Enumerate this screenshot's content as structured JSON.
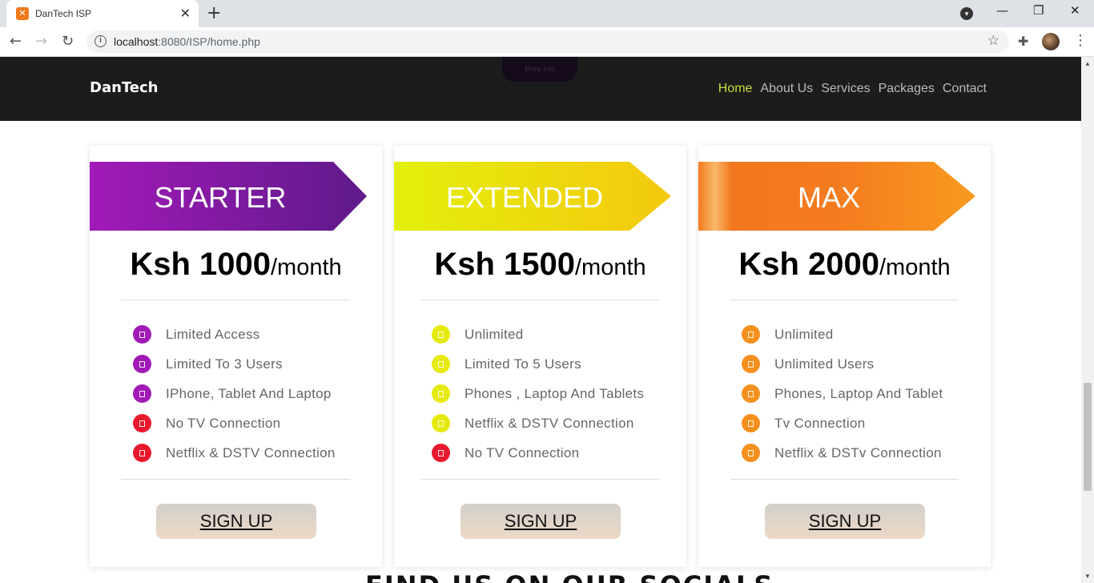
{
  "browser": {
    "tab_title": "DanTech ISP",
    "tab_favicon": "xampp-icon",
    "url_host": "localhost",
    "url_rest": ":8080/ISP/home.php"
  },
  "site": {
    "brand": "DanTech",
    "more_info": "More info",
    "nav": [
      "Home",
      "About Us",
      "Services",
      "Packages",
      "Contact"
    ],
    "active_nav": "Home"
  },
  "plans": [
    {
      "name": "STARTER",
      "currency_amount": "Ksh 1000",
      "period": "/month",
      "accent": "#a01ab5",
      "features": [
        {
          "text": "Limited Access",
          "included": true
        },
        {
          "text": "Limited To 3 Users",
          "included": true
        },
        {
          "text": "IPhone, Tablet And Laptop",
          "included": true
        },
        {
          "text": "No TV Connection",
          "included": false
        },
        {
          "text": "Netflix & DSTV Connection",
          "included": false
        }
      ],
      "cta": "SIGN UP"
    },
    {
      "name": "EXTENDED",
      "currency_amount": "Ksh 1500",
      "period": "/month",
      "accent": "#e5ea0c",
      "features": [
        {
          "text": "Unlimited",
          "included": true
        },
        {
          "text": "Limited To 5 Users",
          "included": true
        },
        {
          "text": "Phones , Laptop And Tablets",
          "included": true
        },
        {
          "text": "Netflix & DSTV Connection",
          "included": true
        },
        {
          "text": "No TV Connection",
          "included": false
        }
      ],
      "cta": "SIGN UP"
    },
    {
      "name": "MAX",
      "currency_amount": "Ksh 2000",
      "period": "/month",
      "accent": "#f5901e",
      "features": [
        {
          "text": "Unlimited",
          "included": true
        },
        {
          "text": "Unlimited Users",
          "included": true
        },
        {
          "text": "Phones, Laptop And Tablet",
          "included": true
        },
        {
          "text": "Tv Connection",
          "included": true
        },
        {
          "text": "Netflix & DSTv Connection",
          "included": true
        }
      ],
      "cta": "SIGN UP"
    }
  ],
  "colors": {
    "excluded": "#e8192c",
    "header_bg": "#1c1c1c",
    "active_nav": "#cddc39"
  },
  "socials_heading": "FIND US ON OUR SOCIALS"
}
